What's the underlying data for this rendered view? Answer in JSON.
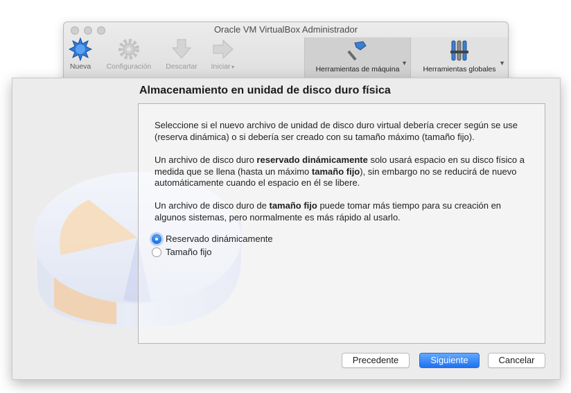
{
  "window": {
    "title": "Oracle VM VirtualBox Administrador"
  },
  "toolbar": {
    "items": [
      {
        "label": "Nueva",
        "icon": "new-star-icon",
        "enabled": true
      },
      {
        "label": "Configuración",
        "icon": "gear-icon",
        "enabled": false
      },
      {
        "label": "Descartar",
        "icon": "discard-arrow-down-icon",
        "enabled": false
      },
      {
        "label": "Iniciar",
        "icon": "start-arrow-right-icon",
        "enabled": false
      }
    ],
    "machine_tools_label": "Herramientas de máquina",
    "global_tools_label": "Herramientas globales"
  },
  "wizard": {
    "title": "Almacenamiento en unidad de disco duro física",
    "para1": "Seleccione si el nuevo archivo de unidad de disco duro virtual debería crecer según se use (reserva dinámica) o si debería ser creado con su tamaño máximo (tamaño fijo).",
    "para2_parts": {
      "a": "Un archivo de disco duro ",
      "b": "reservado dinámicamente",
      "c": " solo usará espacio en su disco físico a medida que se llena (hasta un máximo ",
      "d": "tamaño fijo",
      "e": "), sin embargo no se reducirá de nuevo automáticamente cuando el espacio en él se libere."
    },
    "para3_parts": {
      "a": "Un archivo de disco duro de ",
      "b": "tamaño fijo",
      "c": " puede tomar más tiempo para su creación en algunos sistemas, pero normalmente es más rápido al usarlo."
    },
    "options": [
      {
        "label": "Reservado dinámicamente",
        "selected": true
      },
      {
        "label": "Tamaño fijo",
        "selected": false
      }
    ],
    "buttons": {
      "back": "Precedente",
      "next": "Siguiente",
      "cancel": "Cancelar"
    }
  },
  "colors": {
    "accent": "#1e72ef",
    "sheet_bg": "#ececec"
  }
}
